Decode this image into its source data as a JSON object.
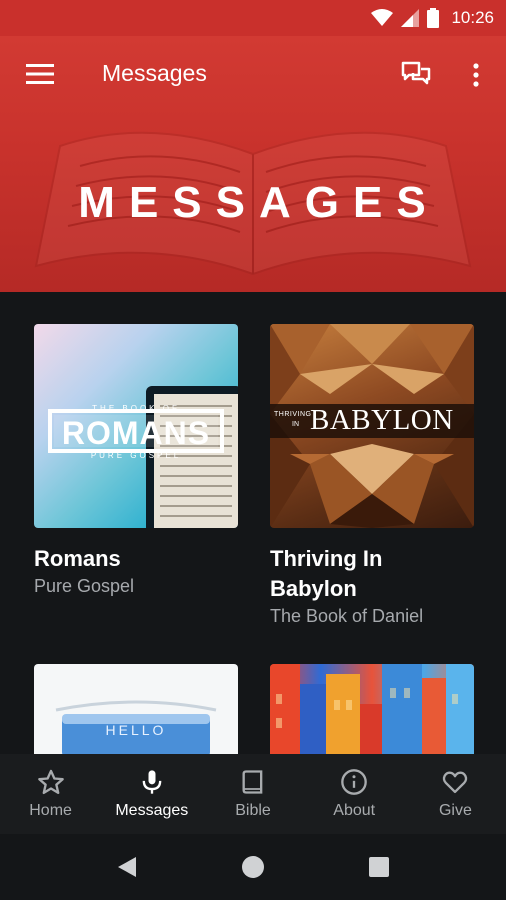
{
  "status_bar": {
    "time": "10:26"
  },
  "app_bar": {
    "title": "Messages"
  },
  "banner": {
    "text": "MESSAGES"
  },
  "cards": [
    {
      "title": "Romans",
      "subtitle": "Pure Gospel",
      "art_text": {
        "top": "THE BOOK OF",
        "main": "ROMANS",
        "bottom": "PURE GOSPEL"
      }
    },
    {
      "title": "Thriving In Babylon",
      "subtitle": "The Book of Daniel",
      "art_text": {
        "prefix_top": "THRIVING",
        "prefix_bottom": "IN",
        "main": "BABYLON"
      }
    },
    {
      "title": "",
      "subtitle": "",
      "art_text": {
        "main": "HELLO"
      }
    },
    {
      "title": "",
      "subtitle": "",
      "art_text": {}
    }
  ],
  "bottom_nav": [
    {
      "label": "Home",
      "icon": "star-icon",
      "active": false
    },
    {
      "label": "Messages",
      "icon": "microphone-icon",
      "active": true
    },
    {
      "label": "Bible",
      "icon": "book-icon",
      "active": false
    },
    {
      "label": "About",
      "icon": "info-icon",
      "active": false
    },
    {
      "label": "Give",
      "icon": "heart-icon",
      "active": false
    }
  ],
  "colors": {
    "header": "#c9302c",
    "background": "#141618",
    "nav_inactive": "#a8abae"
  }
}
